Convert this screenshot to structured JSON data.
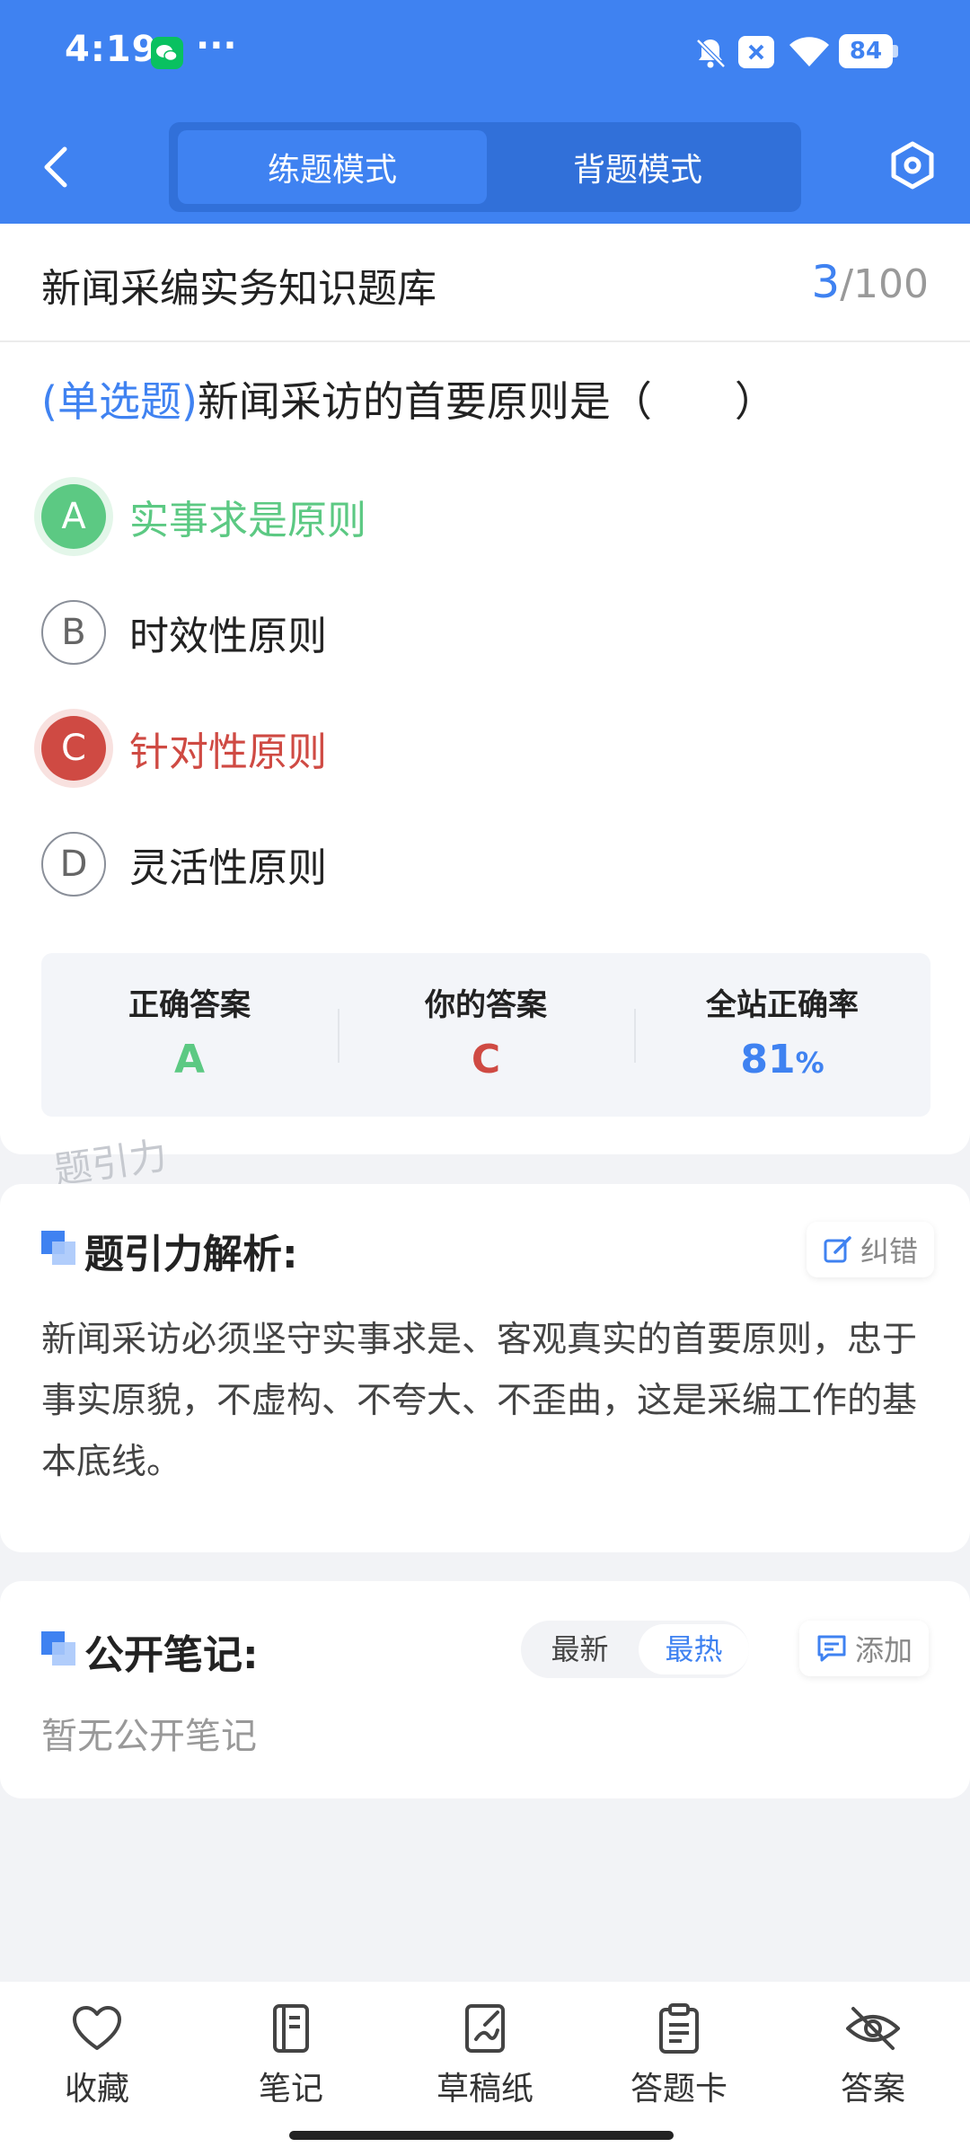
{
  "status_bar": {
    "time": "4:19",
    "dots": "···",
    "battery": "84"
  },
  "header": {
    "tabs": [
      {
        "label": "练题模式",
        "active": true
      },
      {
        "label": "背题模式",
        "active": false
      }
    ]
  },
  "question_card": {
    "bank_title": "新闻采编实务知识题库",
    "progress_current": "3",
    "progress_total": "/100",
    "question_type": "(单选题)",
    "question_text": "新闻采访的首要原则是（　　）",
    "options": [
      {
        "letter": "A",
        "text": "实事求是原则",
        "state": "correct"
      },
      {
        "letter": "B",
        "text": "时效性原则",
        "state": "normal"
      },
      {
        "letter": "C",
        "text": "针对性原则",
        "state": "wrong"
      },
      {
        "letter": "D",
        "text": "灵活性原则",
        "state": "normal"
      }
    ],
    "answer_summary": {
      "correct_label": "正确答案",
      "correct_value": "A",
      "yours_label": "你的答案",
      "yours_value": "C",
      "rate_label": "全站正确率",
      "rate_value": "81",
      "rate_unit": "%"
    },
    "watermark": "题引力"
  },
  "analysis": {
    "title": "题引力解析:",
    "report_label": "纠错",
    "text": "新闻采访必须坚守实事求是、客观真实的首要原则，忠于事实原貌，不虚构、不夸大、不歪曲，这是采编工作的基本底线。"
  },
  "notes": {
    "title": "公开笔记:",
    "sort_options": [
      {
        "label": "最新",
        "active": false
      },
      {
        "label": "最热",
        "active": true
      }
    ],
    "add_label": "添加",
    "empty_text": "暂无公开笔记"
  },
  "bottom_nav": [
    {
      "label": "收藏",
      "icon": "heart-icon"
    },
    {
      "label": "笔记",
      "icon": "notebook-icon"
    },
    {
      "label": "草稿纸",
      "icon": "draft-paper-icon"
    },
    {
      "label": "答题卡",
      "icon": "answer-sheet-icon"
    },
    {
      "label": "答案",
      "icon": "eye-off-icon"
    }
  ],
  "colors": {
    "brand": "#3f82f1",
    "correct": "#5cc983",
    "wrong": "#cf4a43"
  }
}
